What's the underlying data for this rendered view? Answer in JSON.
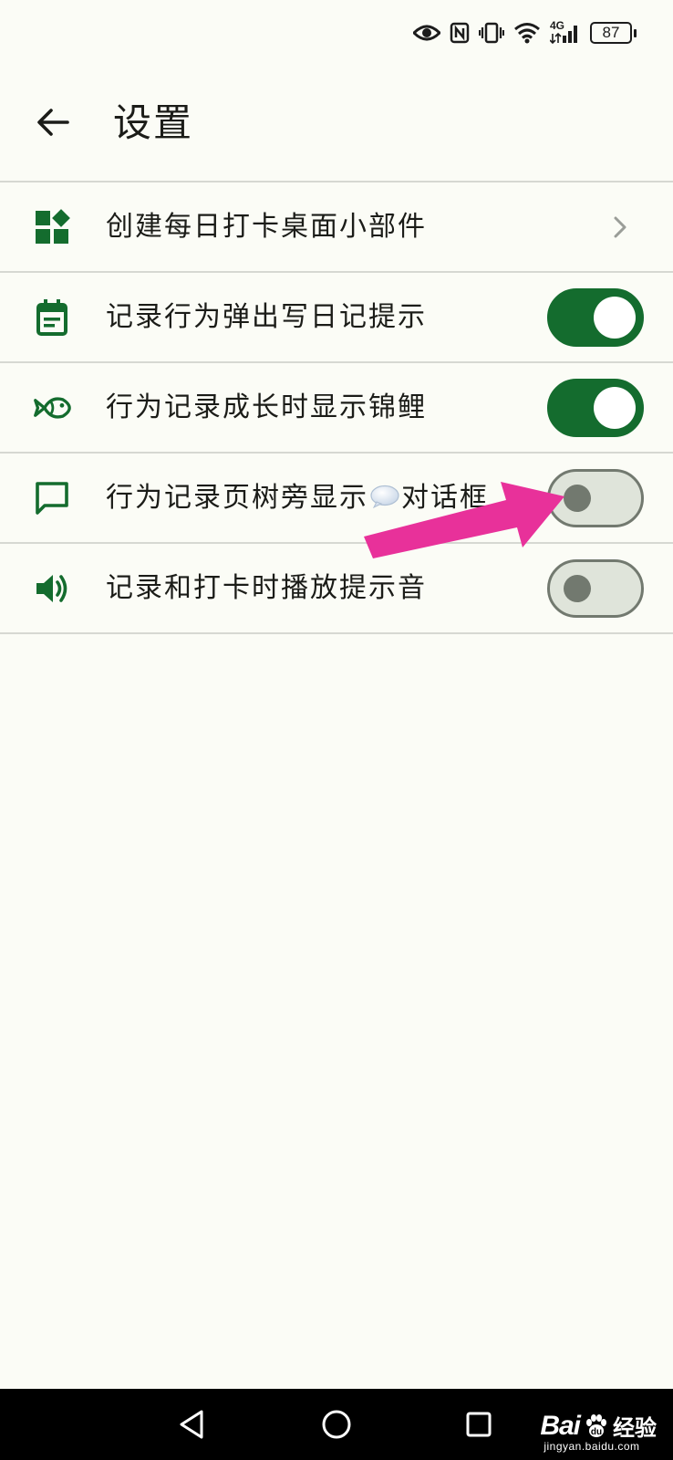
{
  "status_bar": {
    "battery": "87",
    "network": "4G"
  },
  "header": {
    "title": "设置",
    "back_icon": "arrow-left-icon"
  },
  "settings": [
    {
      "label": "创建每日打卡桌面小部件",
      "icon": "widgets-icon",
      "control": "chevron"
    },
    {
      "label": "记录行为弹出写日记提示",
      "icon": "calendar-note-icon",
      "control": "toggle",
      "on": true
    },
    {
      "label": "行为记录成长时显示锦鲤",
      "icon": "fish-icon",
      "control": "toggle",
      "on": true
    },
    {
      "label_before": "行为记录页树旁显示",
      "label_emoji": "speech-bubble-emoji",
      "label_after": "对话框",
      "icon": "chat-bubble-icon",
      "control": "toggle",
      "on": false
    },
    {
      "label": "记录和打卡时播放提示音",
      "icon": "volume-icon",
      "control": "toggle",
      "on": false
    }
  ],
  "nav_bar": {
    "buttons": [
      "back-triangle-icon",
      "home-circle-icon",
      "recents-square-icon"
    ]
  },
  "watermark": {
    "brand_left": "Bai",
    "brand_right": "经验",
    "url": "jingyan.baidu.com"
  },
  "colors": {
    "accent": "#146c2e",
    "background": "#fbfcf6",
    "toggle_off_track": "#dfe4da",
    "toggle_off_knob": "#72796f",
    "annotation_arrow": "#e8319a",
    "divider": "#d6d8d2"
  }
}
